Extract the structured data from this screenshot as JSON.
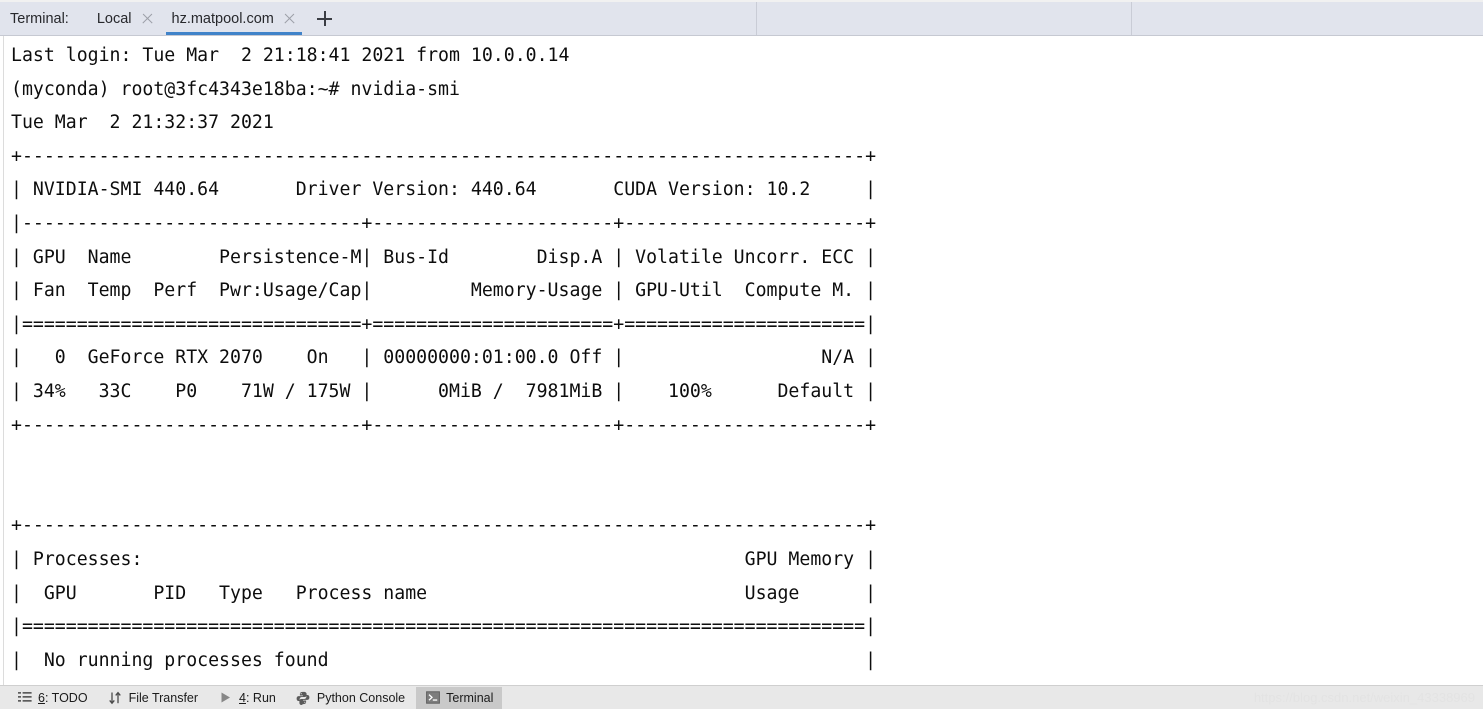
{
  "window": {
    "app": "PyCharm Terminal",
    "accent_color": "#4083c9",
    "tabbar_bg": "#e1e4ed",
    "statusbar_bg": "#e8e8e8"
  },
  "tabbar": {
    "label": "Terminal:",
    "tabs": [
      {
        "title": "Local",
        "active": false,
        "closable": true
      },
      {
        "title": "hz.matpool.com",
        "active": true,
        "closable": true
      }
    ],
    "add_tab_label": "+",
    "add_tab_icon": "plus-icon",
    "close_icon": "close-icon"
  },
  "terminal": {
    "prompt_user": "root@3fc4343e18ba",
    "conda_env": "myconda",
    "command": "nvidia-smi",
    "lines": [
      "Last login: Tue Mar  2 21:18:41 2021 from 10.0.0.14",
      "(myconda) root@3fc4343e18ba:~# nvidia-smi",
      "Tue Mar  2 21:32:37 2021",
      "+-----------------------------------------------------------------------------+",
      "| NVIDIA-SMI 440.64       Driver Version: 440.64       CUDA Version: 10.2     |",
      "|-------------------------------+----------------------+----------------------+",
      "| GPU  Name        Persistence-M| Bus-Id        Disp.A | Volatile Uncorr. ECC |",
      "| Fan  Temp  Perf  Pwr:Usage/Cap|         Memory-Usage | GPU-Util  Compute M. |",
      "|===============================+======================+======================|",
      "|   0  GeForce RTX 2070    On   | 00000000:01:00.0 Off |                  N/A |",
      "| 34%   33C    P0    71W / 175W |      0MiB /  7981MiB |    100%      Default |",
      "+-------------------------------+----------------------+----------------------+",
      "",
      "",
      "+-----------------------------------------------------------------------------+",
      "| Processes:                                                       GPU Memory |",
      "|  GPU       PID   Type   Process name                             Usage      |",
      "|=============================================================================|",
      "|  No running processes found                                                 |",
      "+-----------------------------------------------------------------------------+"
    ],
    "nvidia_smi": {
      "header": {
        "smi_version": "440.64",
        "driver_version_label": "Driver Version:",
        "driver_version": "440.64",
        "cuda_version_label": "CUDA Version:",
        "cuda_version": "10.2"
      },
      "columns_row1": [
        "GPU",
        "Name",
        "Persistence-M",
        "Bus-Id",
        "Disp.A",
        "Volatile Uncorr. ECC"
      ],
      "columns_row2": [
        "Fan",
        "Temp",
        "Perf",
        "Pwr:Usage/Cap",
        "Memory-Usage",
        "GPU-Util",
        "Compute M."
      ],
      "gpus": [
        {
          "index": "0",
          "name": "GeForce RTX 2070",
          "persistence_m": "On",
          "bus_id": "00000000:01:00.0",
          "disp_a": "Off",
          "ecc": "N/A",
          "fan": "34%",
          "temp": "33C",
          "perf": "P0",
          "power": "71W / 175W",
          "memory": "0MiB /  7981MiB",
          "gpu_util": "100%",
          "compute_m": "Default"
        }
      ],
      "processes": {
        "title": "Processes:",
        "gpu_memory_label": "GPU Memory",
        "columns": [
          "GPU",
          "PID",
          "Type",
          "Process name",
          "Usage"
        ],
        "empty_message": "No running processes found"
      }
    },
    "timestamp": "Tue Mar  2 21:32:37 2021",
    "last_login": "Last login: Tue Mar  2 21:18:41 2021 from 10.0.0.14"
  },
  "statusbar": {
    "items": [
      {
        "mnemonic": "6",
        "label": ": TODO",
        "icon": "todo-list-icon",
        "active": false
      },
      {
        "mnemonic": "",
        "label": "File Transfer",
        "icon": "file-transfer-icon",
        "active": false
      },
      {
        "mnemonic": "4",
        "label": ": Run",
        "icon": "run-play-icon",
        "active": false
      },
      {
        "mnemonic": "",
        "label": "Python Console",
        "icon": "python-icon",
        "active": false
      },
      {
        "mnemonic": "",
        "label": "Terminal",
        "icon": "terminal-icon",
        "active": true
      }
    ],
    "watermark": "https://blog.csdn.net/weixin_43338969"
  }
}
